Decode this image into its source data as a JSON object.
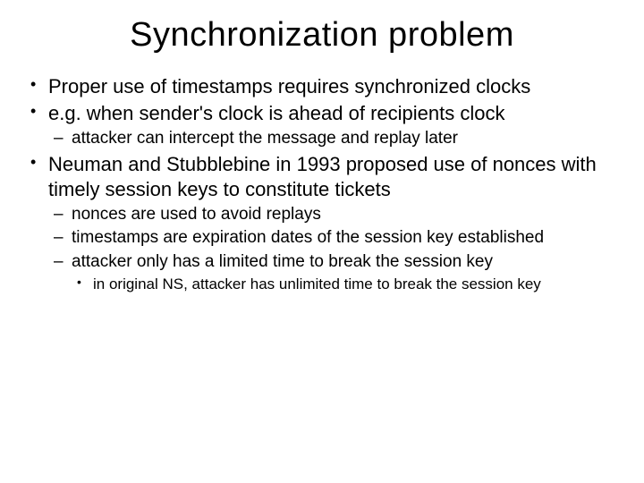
{
  "title": "Synchronization problem",
  "bullets": {
    "b1": "Proper use of timestamps requires synchronized clocks",
    "b2": "e.g. when sender's clock is ahead of recipients clock",
    "b2_1": "attacker can intercept the message and replay later",
    "b3": "Neuman and Stubblebine in 1993 proposed use of nonces with timely session keys to constitute tickets",
    "b3_1": "nonces are used to avoid replays",
    "b3_2": "timestamps are expiration dates of the session key established",
    "b3_3": "attacker only has a limited time to break the session key",
    "b3_3_1": "in original NS, attacker has unlimited time to break the session key"
  }
}
